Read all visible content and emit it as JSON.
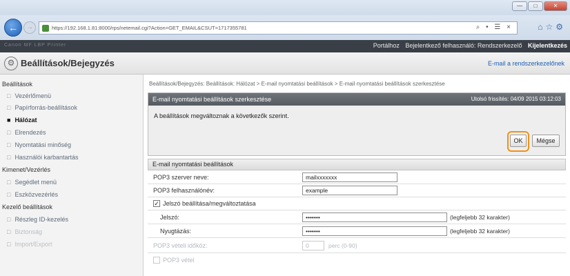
{
  "browser": {
    "url": "https://192.168.1.81:8000/rps/netemail.cgi?Action=GET_EMAIL&CSUT=1717355781",
    "addr_tools": "⌕ • ☰ ×",
    "window_buttons": [
      "—",
      "□",
      "✕"
    ],
    "icons": [
      "home-icon",
      "star-icon",
      "gear-icon"
    ]
  },
  "header": {
    "device_name": "Canon MF LBP Printer",
    "portal_link": "Portálhoz",
    "logged_in": "Bejelentkező felhasználó: Rendszerkezelő",
    "logout": "Kijelentkezés",
    "page_title": "Beállítások/Bejegyzés",
    "mail_admin": "E-mail a rendszerkezelőnek"
  },
  "sidebar": {
    "groups": [
      {
        "label": "Beállítások",
        "items": [
          {
            "label": "Vezérlőmenü",
            "state": "normal"
          },
          {
            "label": "Papírforrás-beállítások",
            "state": "normal"
          },
          {
            "label": "Hálózat",
            "state": "active"
          },
          {
            "label": "Elrendezés",
            "state": "normal"
          },
          {
            "label": "Nyomtatási minőség",
            "state": "normal"
          },
          {
            "label": "Használói karbantartás",
            "state": "normal"
          }
        ]
      },
      {
        "label": "Kimenet/Vezérlés",
        "items": [
          {
            "label": "Segédlet menü",
            "state": "normal"
          },
          {
            "label": "Eszközvezérlés",
            "state": "normal"
          }
        ]
      },
      {
        "label": "Kezelő beállítások",
        "items": [
          {
            "label": "Részleg ID-kezelés",
            "state": "normal"
          },
          {
            "label": "Biztonság",
            "state": "faded"
          },
          {
            "label": "Import/Export",
            "state": "faded"
          }
        ]
      }
    ]
  },
  "main": {
    "breadcrumb": "Beállítások/Bejegyzés: Beállítások: Hálózat > E-mail nyomtatási beállítások > E-mail nyomtatási beállítások szerkesztése",
    "panel_title": "E-mail nyomtatási beállítások szerkesztése",
    "last_updated": "Utolsó frissítés: 04/09 2015 03:12:03",
    "message": "A beállítások megváltoznak a következők szerint.",
    "ok_label": "OK",
    "cancel_label": "Mégse",
    "section_title": "E-mail nyomtatási beállítások",
    "pop3_server_label": "POP3 szerver neve:",
    "pop3_server_value": "mailxxxxxxx",
    "pop3_user_label": "POP3 felhasználónév:",
    "pop3_user_value": "example",
    "password_change_label": "Jelszó beállítása/megváltoztatása",
    "password_change_checked": "✓",
    "password_label": "Jelszó:",
    "password_value": "•••••••",
    "password_hint": "(legfeljebb 32 karakter)",
    "confirm_label": "Nyugtázás:",
    "confirm_value": "•••••••",
    "confirm_hint": "(legfeljebb 32 karakter)",
    "pop3_timeout_label": "POP3 vételi időköz:",
    "pop3_timeout_value": "0",
    "pop3_timeout_unit": "perc (0-90)",
    "pop3_receive_label": "POP3 vétel"
  }
}
